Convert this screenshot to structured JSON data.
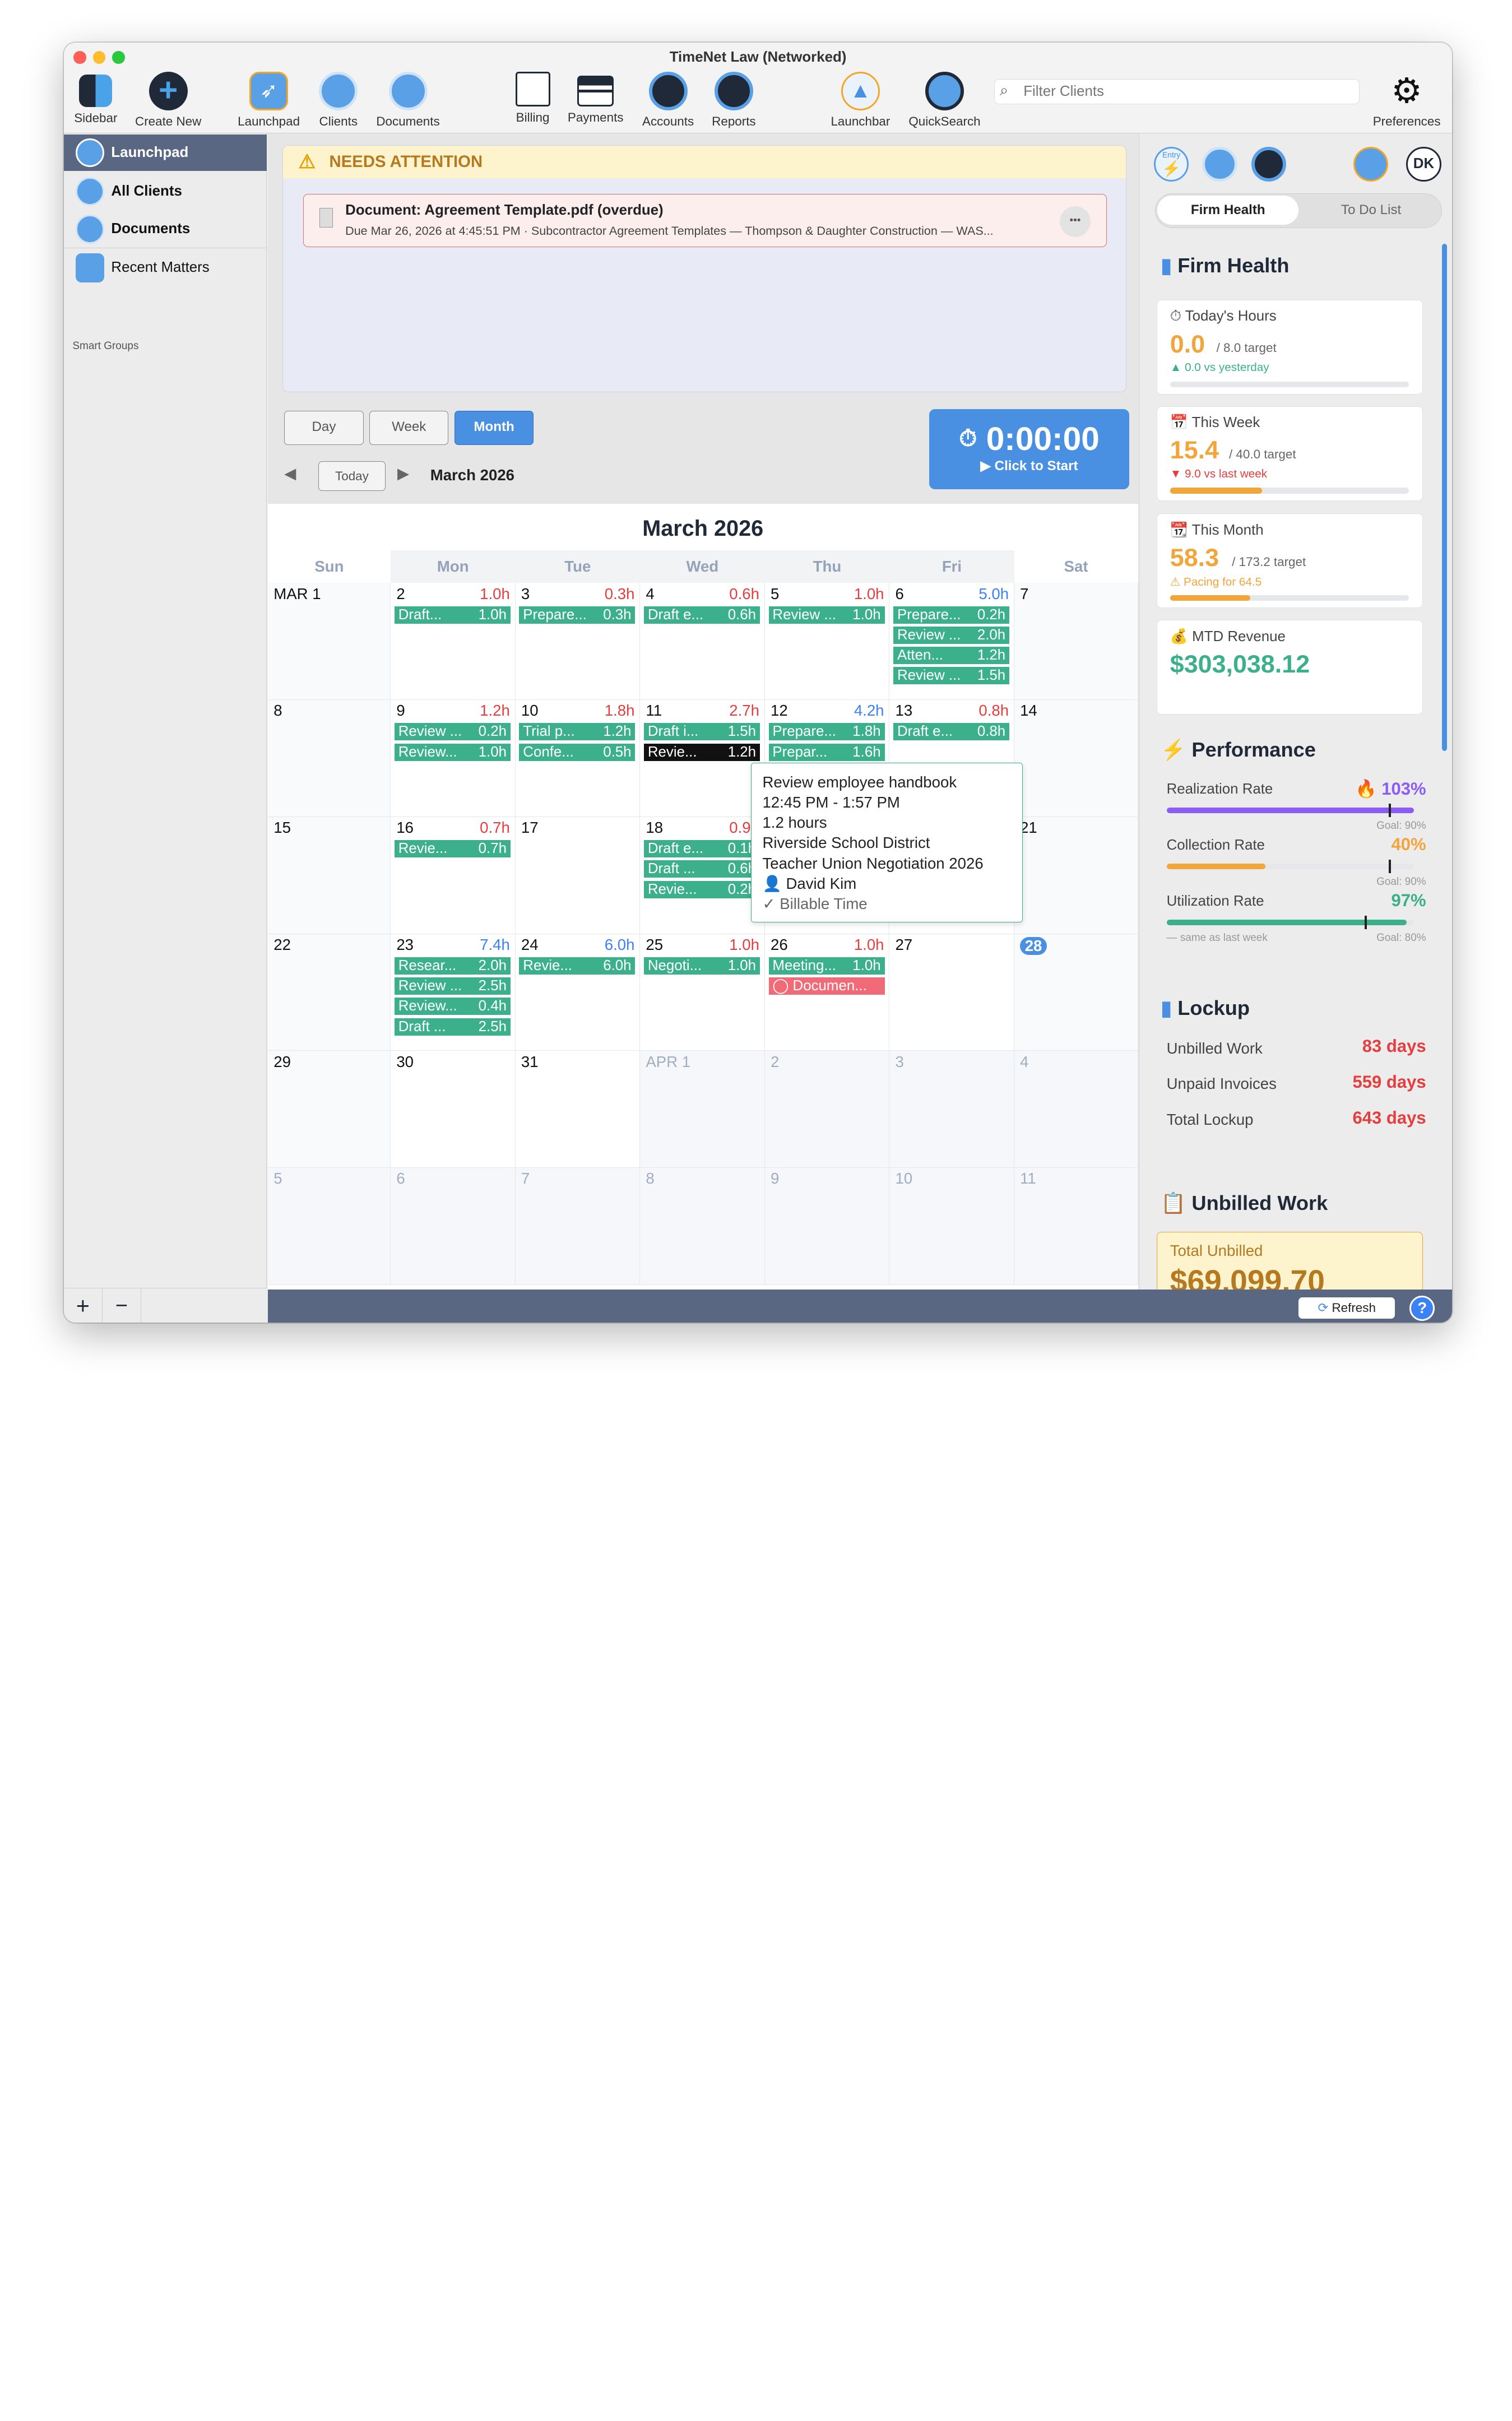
{
  "window": {
    "title": "TimeNet Law (Networked)"
  },
  "toolbar": {
    "sidebar": "Sidebar",
    "create_new": "Create New",
    "launchpad": "Launchpad",
    "clients": "Clients",
    "documents": "Documents",
    "billing": "Billing",
    "payments": "Payments",
    "accounts": "Accounts",
    "reports": "Reports",
    "launchbar": "Launchbar",
    "quicksearch": "QuickSearch",
    "preferences": "Preferences",
    "filter_placeholder": "Filter Clients"
  },
  "sidebar": {
    "launchpad": "Launchpad",
    "all_clients": "All Clients",
    "documents": "Documents",
    "recent_matters": "Recent Matters",
    "smart_groups": "Smart Groups",
    "add": "+",
    "remove": "−"
  },
  "attention": {
    "title": "NEEDS ATTENTION",
    "doc_title": "Document: Agreement Template.pdf (overdue)",
    "doc_detail": "Due Mar 26, 2026 at 4:45:51 PM · Subcontractor Agreement Templates — Thompson & Daughter Construction — WAS...",
    "more": "•••"
  },
  "view": {
    "day": "Day",
    "week": "Week",
    "month": "Month",
    "today": "Today",
    "period": "March 2026",
    "selected": "Month"
  },
  "timer": {
    "time": "0:00:00",
    "action": "▶ Click to Start"
  },
  "calendar": {
    "title": "March 2026",
    "weekdays": [
      "Sun",
      "Mon",
      "Tue",
      "Wed",
      "Thu",
      "Fri",
      "Sat"
    ],
    "weeks": [
      [
        {
          "d": "MAR 1"
        },
        {
          "d": "2",
          "h": "1.0h",
          "hc": "red",
          "e": [
            [
              "Draft...",
              "1.0h"
            ]
          ]
        },
        {
          "d": "3",
          "h": "0.3h",
          "hc": "red",
          "e": [
            [
              "Prepare...",
              "0.3h"
            ]
          ]
        },
        {
          "d": "4",
          "h": "0.6h",
          "hc": "red",
          "e": [
            [
              "Draft e...",
              "0.6h"
            ]
          ]
        },
        {
          "d": "5",
          "h": "1.0h",
          "hc": "red",
          "e": [
            [
              "Review ...",
              "1.0h"
            ]
          ]
        },
        {
          "d": "6",
          "h": "5.0h",
          "hc": "blue",
          "e": [
            [
              "Prepare...",
              "0.2h"
            ],
            [
              "Review ...",
              "2.0h"
            ],
            [
              "Atten...",
              "1.2h"
            ],
            [
              "Review ...",
              "1.5h"
            ]
          ]
        },
        {
          "d": "7"
        }
      ],
      [
        {
          "d": "8"
        },
        {
          "d": "9",
          "h": "1.2h",
          "hc": "red",
          "e": [
            [
              "Review ...",
              "0.2h"
            ],
            [
              "Review...",
              "1.0h"
            ]
          ]
        },
        {
          "d": "10",
          "h": "1.8h",
          "hc": "red",
          "e": [
            [
              "Trial p...",
              "1.2h"
            ],
            [
              "Confe...",
              "0.5h"
            ]
          ]
        },
        {
          "d": "11",
          "h": "2.7h",
          "hc": "red",
          "e": [
            [
              "Draft i...",
              "1.5h"
            ],
            [
              "Revie...",
              "1.2h",
              "sel"
            ]
          ]
        },
        {
          "d": "12",
          "h": "4.2h",
          "hc": "blue",
          "e": [
            [
              "Prepare...",
              "1.8h"
            ],
            [
              "Prepar...",
              "1.6h"
            ]
          ]
        },
        {
          "d": "13",
          "h": "0.8h",
          "hc": "red",
          "e": [
            [
              "Draft e...",
              "0.8h"
            ]
          ]
        },
        {
          "d": "14"
        }
      ],
      [
        {
          "d": "15"
        },
        {
          "d": "16",
          "h": "0.7h",
          "hc": "red",
          "e": [
            [
              "Revie...",
              "0.7h"
            ]
          ]
        },
        {
          "d": "17"
        },
        {
          "d": "18",
          "h": "0.9h",
          "hc": "red",
          "e": [
            [
              "Draft e...",
              "0.1h"
            ],
            [
              "Draft ...",
              "0.6h"
            ],
            [
              "Revie...",
              "0.2h"
            ]
          ]
        },
        {
          "d": ""
        },
        {
          "d": ""
        },
        {
          "d": "21"
        }
      ],
      [
        {
          "d": "22"
        },
        {
          "d": "23",
          "h": "7.4h",
          "hc": "blue",
          "e": [
            [
              "Resear...",
              "2.0h"
            ],
            [
              "Review ...",
              "2.5h"
            ],
            [
              "Review...",
              "0.4h"
            ],
            [
              "Draft ...",
              "2.5h"
            ]
          ]
        },
        {
          "d": "24",
          "h": "6.0h",
          "hc": "blue",
          "e": [
            [
              "Revie...",
              "6.0h"
            ]
          ]
        },
        {
          "d": "25",
          "h": "1.0h",
          "hc": "red",
          "e": [
            [
              "Negoti...",
              "1.0h"
            ]
          ]
        },
        {
          "d": "26",
          "h": "1.0h",
          "hc": "red",
          "e": [
            [
              "Meeting...",
              "1.0h"
            ],
            [
              "◯ Documen...",
              "",
              "doc"
            ]
          ]
        },
        {
          "d": "27"
        },
        {
          "d": "28",
          "today": true
        }
      ],
      [
        {
          "d": "29"
        },
        {
          "d": "30"
        },
        {
          "d": "31"
        },
        {
          "d": "APR 1",
          "o": true
        },
        {
          "d": "2",
          "o": true
        },
        {
          "d": "3",
          "o": true
        },
        {
          "d": "4",
          "o": true
        }
      ],
      [
        {
          "d": "5",
          "o": true
        },
        {
          "d": "6",
          "o": true
        },
        {
          "d": "7",
          "o": true
        },
        {
          "d": "8",
          "o": true
        },
        {
          "d": "9",
          "o": true
        },
        {
          "d": "10",
          "o": true
        },
        {
          "d": "11",
          "o": true
        }
      ]
    ]
  },
  "tooltip": {
    "title": "Review employee handbook",
    "time": "12:45 PM - 1:57 PM",
    "duration": "1.2 hours",
    "client": "Riverside School District",
    "matter": "Teacher Union Negotiation 2026",
    "user": "👤 David Kim",
    "type": "✓ Billable Time"
  },
  "right": {
    "avatar": "DK",
    "entry_label": "Entry",
    "tab_health": "Firm Health",
    "tab_todo": "To Do List",
    "firm_health": "Firm Health",
    "today": {
      "label": "⏱ Today's Hours",
      "value": "0.0",
      "target": "/ 8.0 target",
      "delta": "▲ 0.0 vs yesterday",
      "progress": 0.0
    },
    "week": {
      "label": "This Week",
      "value": "15.4",
      "target": "/ 40.0 target",
      "delta": "▼ 9.0 vs last week",
      "progress": 0.385
    },
    "month": {
      "label": "This Month",
      "value": "58.3",
      "target": "/ 173.2 target",
      "delta": "⚠ Pacing for 64.5",
      "progress": 0.337
    },
    "revenue": {
      "label": "MTD Revenue",
      "value": "$303,038.12"
    },
    "performance": "Performance",
    "realization": {
      "label": "Realization Rate",
      "value": "103%",
      "goal": "Goal: 90%",
      "fraction": 1.0
    },
    "collection": {
      "label": "Collection Rate",
      "value": "40%",
      "goal": "Goal: 90%",
      "fraction": 0.4
    },
    "utilization": {
      "label": "Utilization Rate",
      "value": "97%",
      "goal": "Goal: 80%",
      "note": "— same as last week",
      "fraction": 0.97
    },
    "lockup": "Lockup",
    "unbilled_work": {
      "label": "Unbilled Work",
      "value": "83 days"
    },
    "unpaid_invoices": {
      "label": "Unpaid Invoices",
      "value": "559 days"
    },
    "total_lockup": {
      "label": "Total Lockup",
      "value": "643 days"
    },
    "unbilled_title": "Unbilled Work",
    "total_unbilled_label": "Total Unbilled",
    "total_unbilled_value": "$69,099.70",
    "refresh": "Refresh",
    "help": "?"
  },
  "colors": {
    "accent": "#4a90e2",
    "event": "#3cb08a",
    "selected_event": "#111111",
    "doc_event": "#f06a78",
    "red": "#e53e3e",
    "blue": "#3b82f6",
    "orange": "#f2a53a",
    "purple": "#8b5cf6",
    "green": "#3cb08a",
    "footer": "#5a6782"
  }
}
